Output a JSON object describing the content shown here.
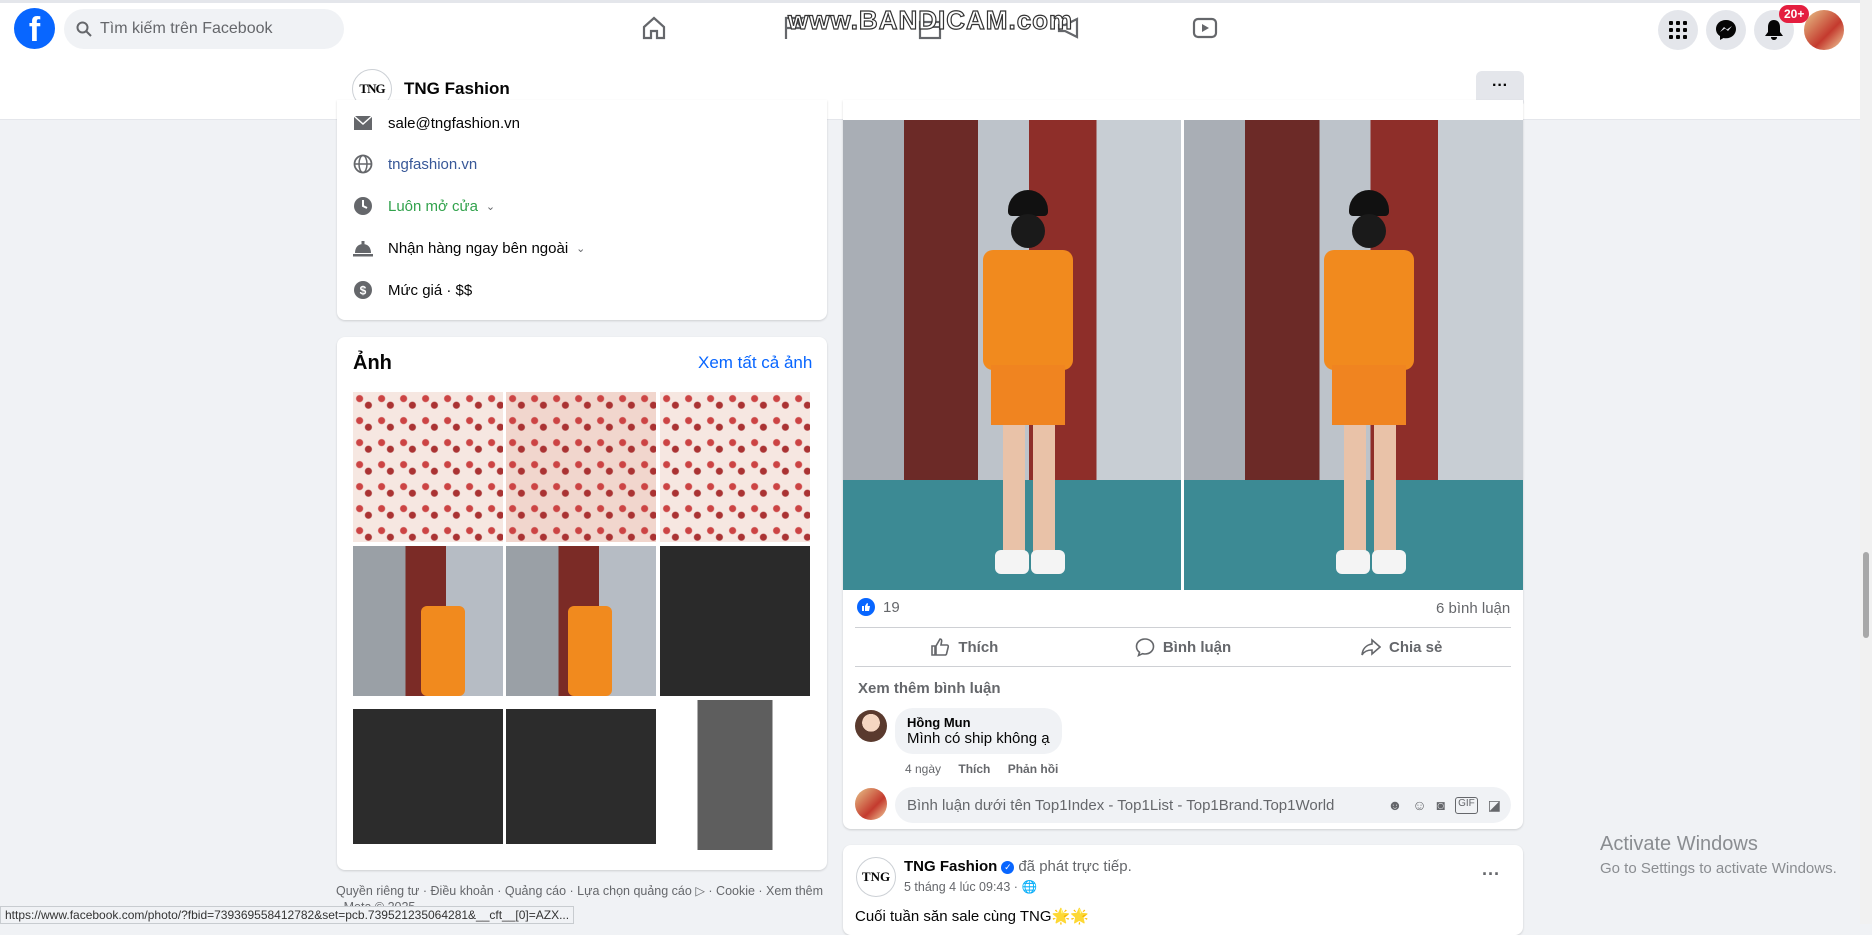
{
  "topbar": {
    "search_placeholder": "Tìm kiếm trên Facebook",
    "watermark": "www.BANDICAM.com",
    "notification_badge": "20+"
  },
  "page": {
    "logo_text": "TNG",
    "name": "TNG Fashion",
    "more_label": "···"
  },
  "intro": {
    "email": "sale@tngfashion.vn",
    "website": "tngfashion.vn",
    "hours": "Luôn mở cửa",
    "pickup": "Nhận hàng ngay bên ngoài",
    "price": "Mức giá · $$"
  },
  "photos": {
    "title": "Ảnh",
    "see_all": "Xem tất cả ảnh"
  },
  "footer": {
    "text": "Quyền riêng tư · Điều khoản · Quảng cáo · Lựa chọn quảng cáo ▷ · Cookie · Xem thêm · Meta © 2025"
  },
  "statusbar": {
    "url": "https://www.facebook.com/photo/?fbid=739369558412782&set=pcb.739521235064281&__cft__[0]=AZX..."
  },
  "post": {
    "like_count": "19",
    "comment_count": "6 bình luận",
    "like_label": "Thích",
    "comment_label": "Bình luận",
    "share_label": "Chia sẻ",
    "more_comments": "Xem thêm bình luận",
    "comment": {
      "author": "Hồng Mun",
      "text": "Mình có ship không ạ",
      "time": "4 ngày",
      "like": "Thích",
      "reply": "Phản hồi"
    },
    "input_placeholder": "Bình luận dưới tên Top1Index - Top1List - Top1Brand.Top1World"
  },
  "post2": {
    "logo_text": "TNG",
    "author": "TNG Fashion",
    "action": "đã phát trực tiếp.",
    "time": "5 tháng 4 lúc 09:43 · 🌐",
    "text": "Cuối tuần săn sale cùng TNG🌟🌟",
    "dots": "···"
  },
  "windows": {
    "activate": "Activate Windows",
    "activate_sub": "Go to Settings to activate Windows."
  },
  "colors": {
    "brand": "#0866ff",
    "page_bg": "#f0f2f5",
    "hours_green": "#31a24c",
    "link": "#385898"
  }
}
